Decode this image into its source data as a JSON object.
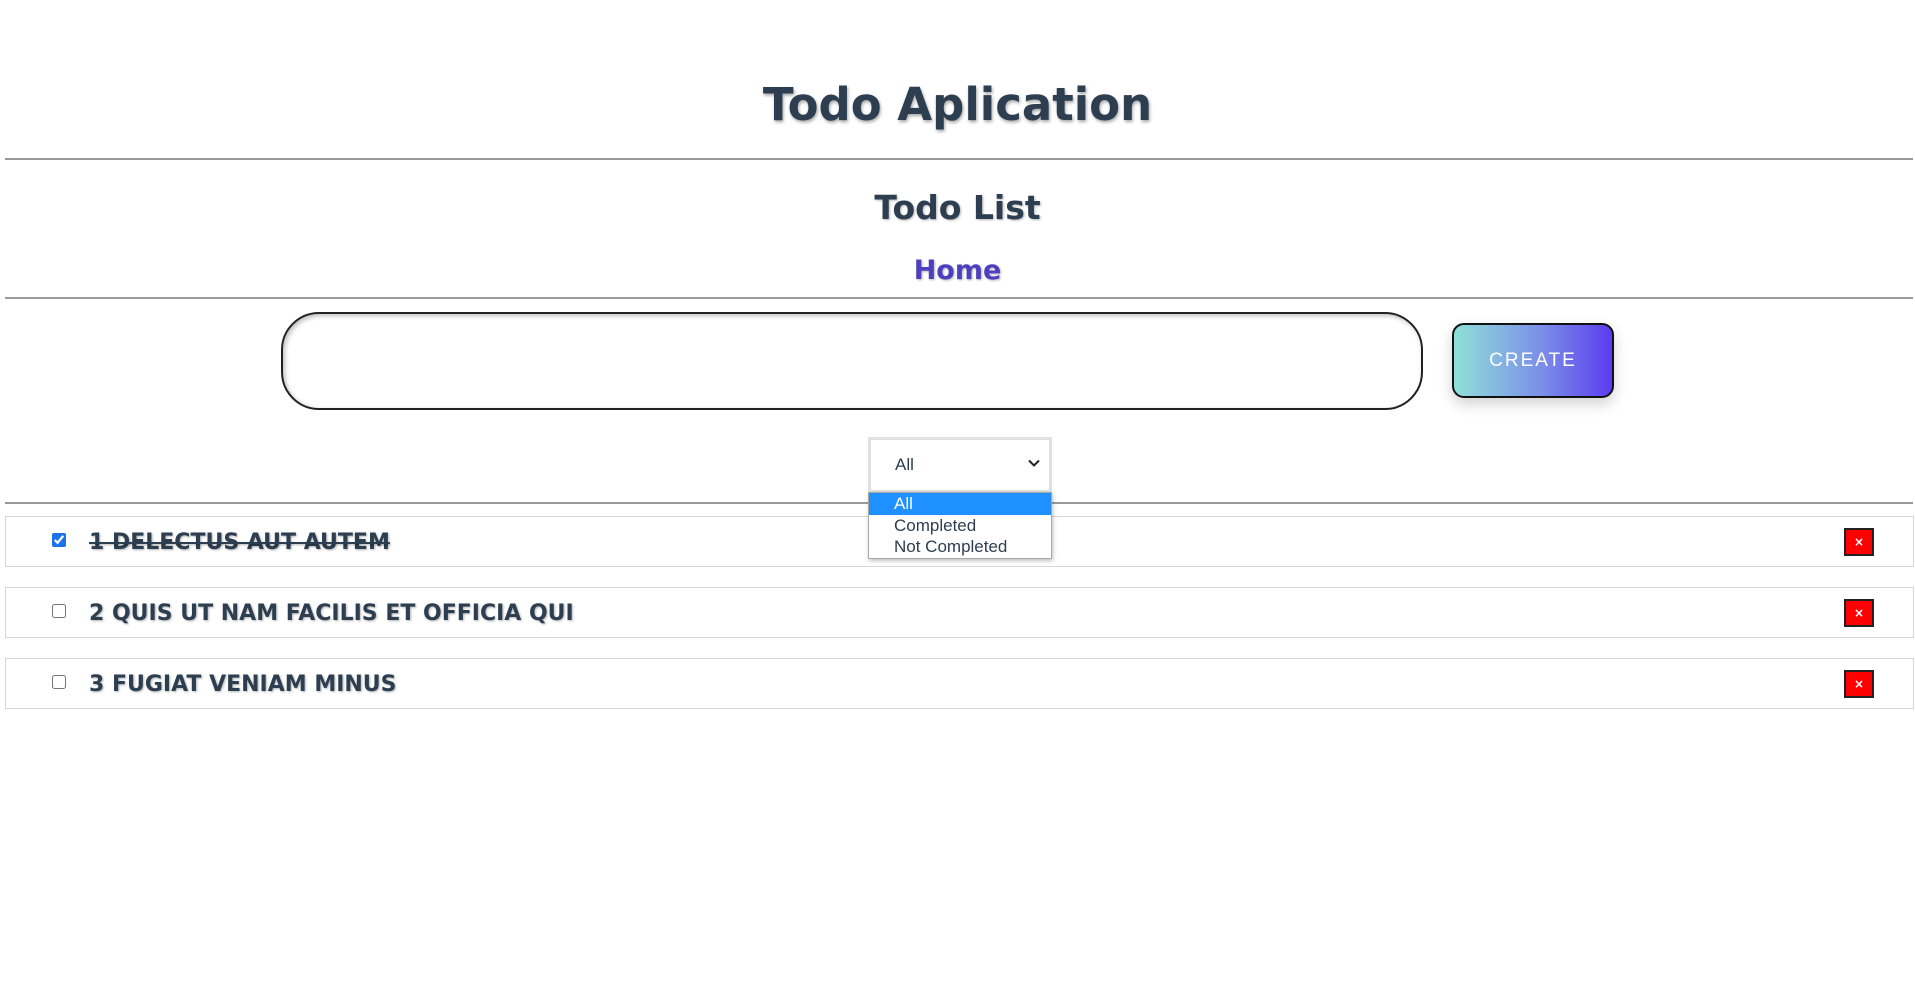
{
  "header": {
    "title": "Todo Aplication"
  },
  "list": {
    "title": "Todo List"
  },
  "nav": {
    "home": "Home"
  },
  "form": {
    "input_value": "",
    "create_label": "CREATE"
  },
  "filter": {
    "selected": "All",
    "options": [
      "All",
      "Completed",
      "Not Completed"
    ],
    "highlighted": "All"
  },
  "todos": [
    {
      "text": "1 delectus aut autem",
      "completed": true,
      "delete_label": "×"
    },
    {
      "text": "2 quis ut nam facilis et officia qui",
      "completed": false,
      "delete_label": "×"
    },
    {
      "text": "3 fugiat veniam minus",
      "completed": false,
      "delete_label": "×"
    }
  ],
  "colors": {
    "accent": "#4f3fbf",
    "delete": "#ff0000",
    "selected_option": "#1e90ff"
  }
}
